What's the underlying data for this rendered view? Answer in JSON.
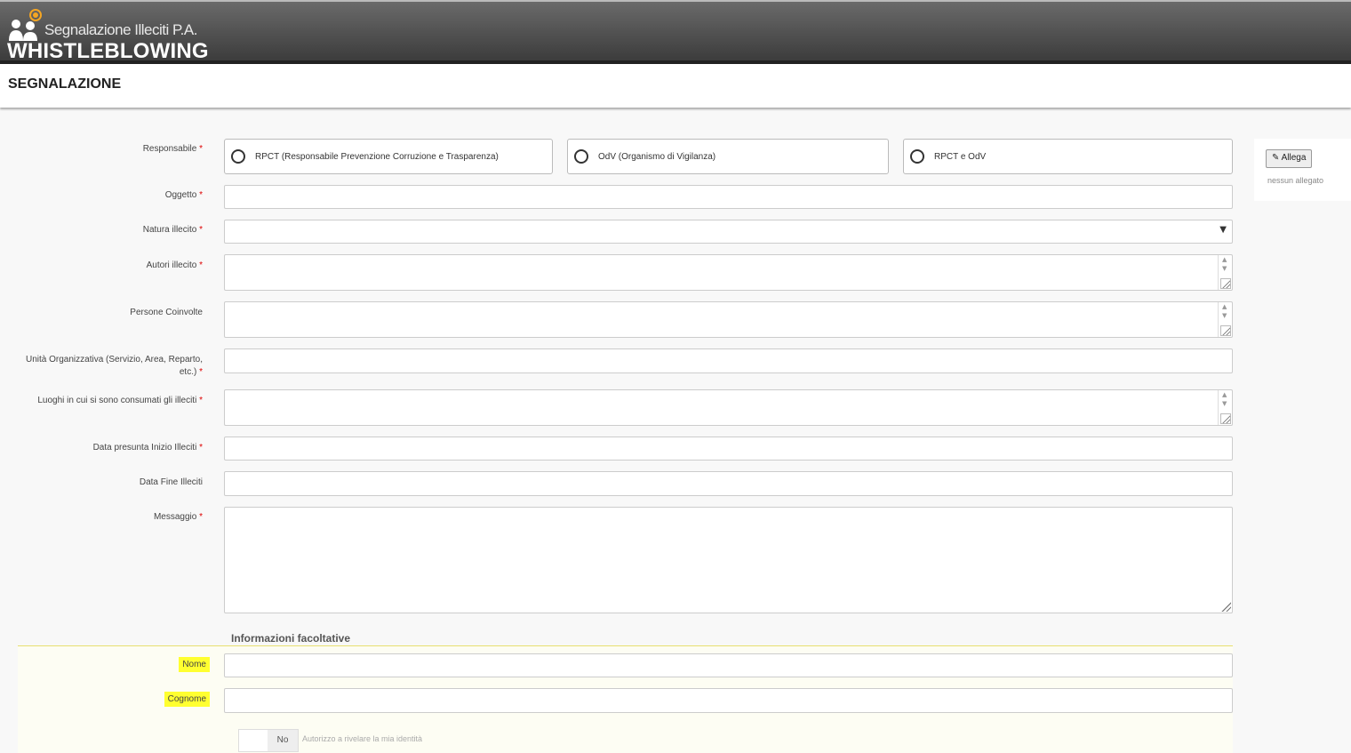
{
  "header": {
    "logo_subtitle": "Segnalazione Illeciti P.A.",
    "logo_title": "WHISTLEBLOWING"
  },
  "page_title": "SEGNALAZIONE",
  "form": {
    "responsabile": {
      "label": "Responsabile",
      "options": [
        "RPCT (Responsabile Prevenzione Corruzione e Trasparenza)",
        "OdV (Organismo di Vigilanza)",
        "RPCT e OdV"
      ]
    },
    "oggetto": {
      "label": "Oggetto"
    },
    "natura": {
      "label": "Natura illecito"
    },
    "autori": {
      "label": "Autori illecito"
    },
    "persone": {
      "label": "Persone Coinvolte"
    },
    "unita": {
      "label_line1": "Unità Organizzativa (Servizio, Area, Reparto,",
      "label_line2": "etc.)"
    },
    "luoghi": {
      "label": "Luoghi in cui si sono consumati gli illeciti"
    },
    "data_inizio": {
      "label": "Data presunta Inizio Illeciti"
    },
    "data_fine": {
      "label": "Data Fine Illeciti"
    },
    "messaggio": {
      "label": "Messaggio"
    },
    "required_mark": "*"
  },
  "attachments": {
    "button_label": "Allega",
    "empty_text": "nessun allegato"
  },
  "optional": {
    "title": "Informazioni facoltative",
    "nome": {
      "label": "Nome"
    },
    "cognome": {
      "label": "Cognome"
    },
    "toggle": {
      "value": "No",
      "label": "Autorizzo a rivelare la mia identità"
    }
  },
  "colors": {
    "header_dark": "#3c3c3c",
    "logo_accent": "#f5a623",
    "highlight": "#ffff30",
    "required": "#dd0000"
  }
}
